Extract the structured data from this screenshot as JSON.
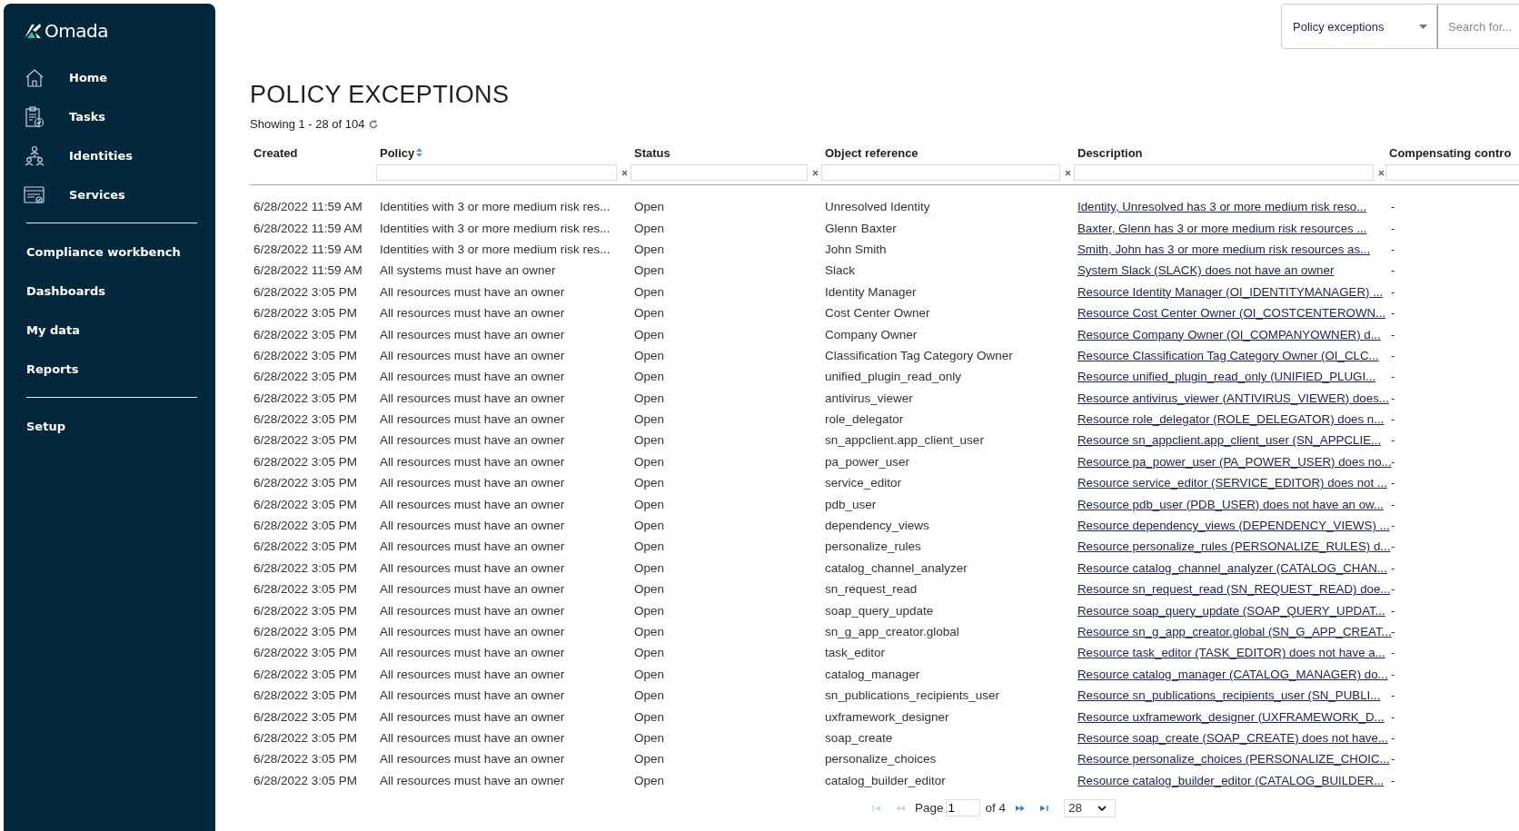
{
  "sidebar": {
    "logo": "Omada",
    "nav_items": [
      {
        "label": "Home",
        "selected": false
      },
      {
        "label": "Tasks",
        "selected": false
      },
      {
        "label": "Identities",
        "selected": false
      },
      {
        "label": "Services",
        "selected": false
      }
    ],
    "sections": [
      {
        "items": [
          "Compliance workbench",
          "Dashboards",
          "My data",
          "Reports"
        ]
      },
      {
        "items": [
          "Setup"
        ]
      }
    ]
  },
  "top_bar": {
    "scope_dropdown": {
      "value": "Policy exceptions"
    },
    "search": {
      "placeholder": "Search for..."
    }
  },
  "page": {
    "title": "POLICY EXCEPTIONS",
    "summary": "Showing 1 - 28 of 104"
  },
  "table": {
    "columns": [
      {
        "label": "Created",
        "filter": false,
        "sortable": false
      },
      {
        "label": "Policy",
        "filter": true,
        "sortable": true
      },
      {
        "label": "Status",
        "filter": true,
        "sortable": false
      },
      {
        "label": "Object reference",
        "filter": true,
        "sortable": false
      },
      {
        "label": "Description",
        "filter": true,
        "sortable": false
      },
      {
        "label": "Compensating contro",
        "filter": true,
        "sortable": false
      }
    ],
    "rows": [
      [
        "6/28/2022 11:59 AM",
        "Identities with 3 or more medium risk res...",
        "Open",
        "Unresolved Identity",
        "Identity, Unresolved has 3 or more medium risk reso...",
        "-"
      ],
      [
        "6/28/2022 11:59 AM",
        "Identities with 3 or more medium risk res...",
        "Open",
        "Glenn Baxter",
        "Baxter, Glenn has 3 or more medium risk resources ...",
        "-"
      ],
      [
        "6/28/2022 11:59 AM",
        "Identities with 3 or more medium risk res...",
        "Open",
        "John Smith",
        "Smith, John has 3 or more medium risk resources as...",
        "-"
      ],
      [
        "6/28/2022 11:59 AM",
        "All systems must have an owner",
        "Open",
        "Slack",
        "System Slack (SLACK) does not have an owner",
        "-"
      ],
      [
        "6/28/2022 3:05 PM",
        "All resources must have an owner",
        "Open",
        "Identity Manager",
        "Resource Identity Manager (OI_IDENTITYMANAGER) ...",
        "-"
      ],
      [
        "6/28/2022 3:05 PM",
        "All resources must have an owner",
        "Open",
        "Cost Center Owner",
        "Resource Cost Center Owner (OI_COSTCENTEROWN...",
        "-"
      ],
      [
        "6/28/2022 3:05 PM",
        "All resources must have an owner",
        "Open",
        "Company Owner",
        "Resource Company Owner (OI_COMPANYOWNER) d...",
        "-"
      ],
      [
        "6/28/2022 3:05 PM",
        "All resources must have an owner",
        "Open",
        "Classification Tag Category Owner",
        "Resource Classification Tag Category Owner (OI_CLC...",
        "-"
      ],
      [
        "6/28/2022 3:05 PM",
        "All resources must have an owner",
        "Open",
        "unified_plugin_read_only",
        "Resource unified_plugin_read_only (UNIFIED_PLUGI...",
        "-"
      ],
      [
        "6/28/2022 3:05 PM",
        "All resources must have an owner",
        "Open",
        "antivirus_viewer",
        "Resource antivirus_viewer (ANTIVIRUS_VIEWER) does...",
        "-"
      ],
      [
        "6/28/2022 3:05 PM",
        "All resources must have an owner",
        "Open",
        "role_delegator",
        "Resource role_delegator (ROLE_DELEGATOR) does n...",
        "-"
      ],
      [
        "6/28/2022 3:05 PM",
        "All resources must have an owner",
        "Open",
        "sn_appclient.app_client_user",
        "Resource sn_appclient.app_client_user (SN_APPCLIE...",
        "-"
      ],
      [
        "6/28/2022 3:05 PM",
        "All resources must have an owner",
        "Open",
        "pa_power_user",
        "Resource pa_power_user (PA_POWER_USER) does no...",
        "-"
      ],
      [
        "6/28/2022 3:05 PM",
        "All resources must have an owner",
        "Open",
        "service_editor",
        "Resource service_editor (SERVICE_EDITOR) does not ...",
        "-"
      ],
      [
        "6/28/2022 3:05 PM",
        "All resources must have an owner",
        "Open",
        "pdb_user",
        "Resource pdb_user (PDB_USER) does not have an ow...",
        "-"
      ],
      [
        "6/28/2022 3:05 PM",
        "All resources must have an owner",
        "Open",
        "dependency_views",
        "Resource dependency_views (DEPENDENCY_VIEWS) ...",
        "-"
      ],
      [
        "6/28/2022 3:05 PM",
        "All resources must have an owner",
        "Open",
        "personalize_rules",
        "Resource personalize_rules (PERSONALIZE_RULES) d...",
        "-"
      ],
      [
        "6/28/2022 3:05 PM",
        "All resources must have an owner",
        "Open",
        "catalog_channel_analyzer",
        "Resource catalog_channel_analyzer (CATALOG_CHAN...",
        "-"
      ],
      [
        "6/28/2022 3:05 PM",
        "All resources must have an owner",
        "Open",
        "sn_request_read",
        "Resource sn_request_read (SN_REQUEST_READ) doe...",
        "-"
      ],
      [
        "6/28/2022 3:05 PM",
        "All resources must have an owner",
        "Open",
        "soap_query_update",
        "Resource soap_query_update (SOAP_QUERY_UPDAT...",
        "-"
      ],
      [
        "6/28/2022 3:05 PM",
        "All resources must have an owner",
        "Open",
        "sn_g_app_creator.global",
        "Resource sn_g_app_creator.global (SN_G_APP_CREAT...",
        "-"
      ],
      [
        "6/28/2022 3:05 PM",
        "All resources must have an owner",
        "Open",
        "task_editor",
        "Resource task_editor (TASK_EDITOR) does not have a...",
        "-"
      ],
      [
        "6/28/2022 3:05 PM",
        "All resources must have an owner",
        "Open",
        "catalog_manager",
        "Resource catalog_manager (CATALOG_MANAGER) do...",
        "-"
      ],
      [
        "6/28/2022 3:05 PM",
        "All resources must have an owner",
        "Open",
        "sn_publications_recipients_user",
        "Resource sn_publications_recipients_user (SN_PUBLI...",
        "-"
      ],
      [
        "6/28/2022 3:05 PM",
        "All resources must have an owner",
        "Open",
        "uxframework_designer",
        "Resource uxframework_designer (UXFRAMEWORK_D...",
        "-"
      ],
      [
        "6/28/2022 3:05 PM",
        "All resources must have an owner",
        "Open",
        "soap_create",
        "Resource soap_create (SOAP_CREATE) does not have...",
        "-"
      ],
      [
        "6/28/2022 3:05 PM",
        "All resources must have an owner",
        "Open",
        "personalize_choices",
        "Resource personalize_choices (PERSONALIZE_CHOIC...",
        "-"
      ],
      [
        "6/28/2022 3:05 PM",
        "All resources must have an owner",
        "Open",
        "catalog_builder_editor",
        "Resource catalog_builder_editor (CATALOG_BUILDER...",
        "-"
      ]
    ]
  },
  "pager": {
    "first_disabled": true,
    "prev_disabled": true,
    "next_disabled": false,
    "last_disabled": false,
    "page_label": "Page",
    "page_value": "1",
    "of_label": "of 4",
    "page_size": "28"
  }
}
